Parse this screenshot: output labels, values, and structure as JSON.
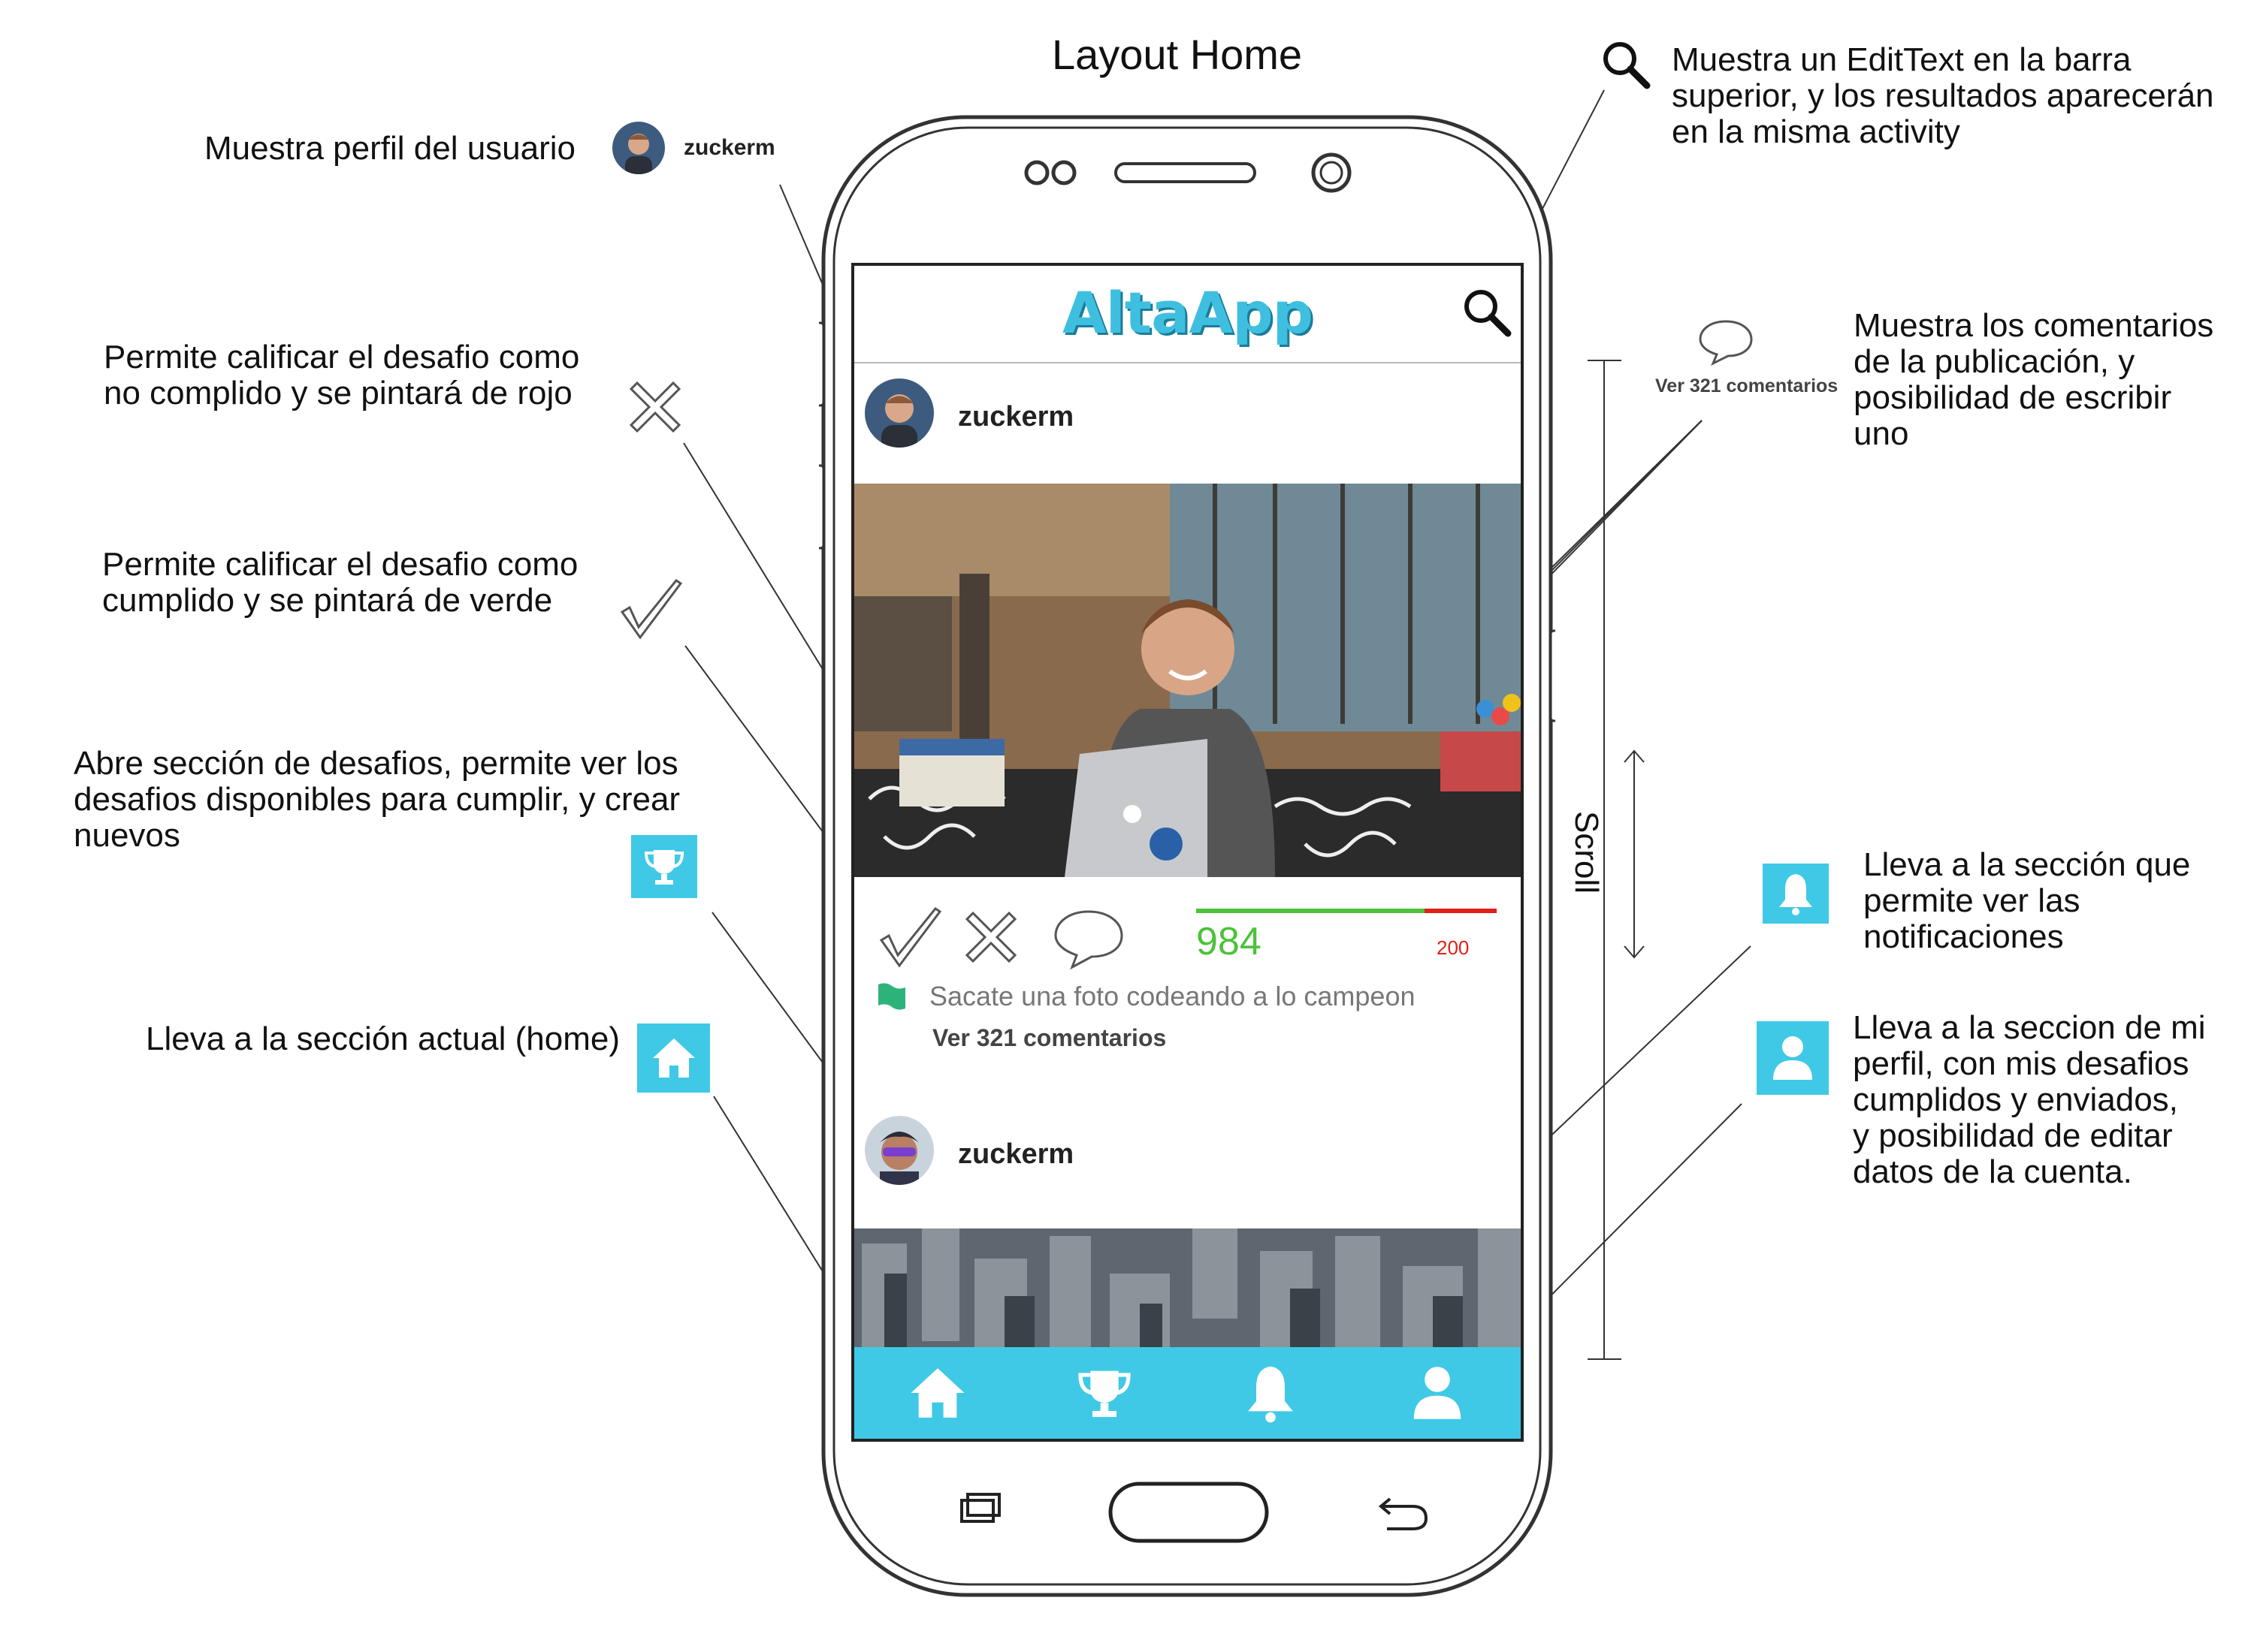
{
  "title": "Layout Home",
  "annotations": {
    "search": "Muestra un EditText en la barra\nsuperior,  y los resultados aparecerán\nen la misma activity",
    "profile": "Muestra perfil del usuario",
    "profile_user": "zuckerm",
    "reject": "Permite calificar el desafio como\nno complido y se pintará de rojo",
    "accept": "Permite calificar el desafio como\ncumplido y se pintará de verde",
    "challenges": "Abre sección de desafios, permite ver los\ndesafios disponibles para cumplir, y crear\nnuevos",
    "home": "Lleva a la sección actual (home)",
    "comments": "Muestra los comentarios\nde la publicación, y\nposibilidad de escribir\nuno",
    "comments_label": "Ver 321 comentarios",
    "notifications": "Lleva a la sección que\npermite ver las\nnotificaciones",
    "my_profile": "Lleva a la seccion de mi\nperfil, con mis desafios\ncumplidos y enviados,\ny posibilidad de editar\ndatos de la cuenta.",
    "scroll": "Scroll"
  },
  "app": {
    "name": "AltaApp",
    "posts": [
      {
        "user": "zuckerm",
        "score": "984",
        "negative": "200",
        "approve_fraction": 0.76,
        "challenge": "Sacate una foto codeando a lo campeon",
        "comments": "Ver 321 comentarios"
      },
      {
        "user": "zuckerm"
      }
    ]
  },
  "colors": {
    "accent": "#3fc9e6",
    "positive": "#4cc23a",
    "negative": "#e0201a",
    "flag": "#2db37a"
  },
  "icons": [
    "search-icon",
    "x-icon",
    "check-icon",
    "comment-icon",
    "trophy-icon",
    "home-icon",
    "bell-icon",
    "person-icon",
    "flag-icon"
  ]
}
